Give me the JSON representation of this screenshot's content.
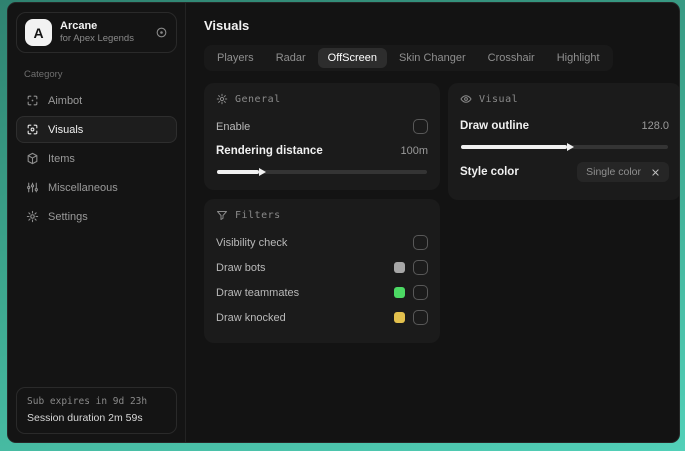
{
  "sidebar": {
    "logo_letter": "A",
    "app_name": "Arcane",
    "app_subtitle": "for Apex Legends",
    "category_label": "Category",
    "items": [
      {
        "label": "Aimbot",
        "active": false
      },
      {
        "label": "Visuals",
        "active": true
      },
      {
        "label": "Items",
        "active": false
      },
      {
        "label": "Miscellaneous",
        "active": false
      },
      {
        "label": "Settings",
        "active": false
      }
    ],
    "footer": {
      "sub_expires": "Sub expires in 9d 23h",
      "session_duration": "Session duration 2m 59s"
    }
  },
  "main": {
    "title": "Visuals",
    "tabs": [
      {
        "label": "Players",
        "active": false
      },
      {
        "label": "Radar",
        "active": false
      },
      {
        "label": "OffScreen",
        "active": true
      },
      {
        "label": "Skin Changer",
        "active": false
      },
      {
        "label": "Crosshair",
        "active": false
      },
      {
        "label": "Highlight",
        "active": false
      }
    ],
    "panels": {
      "general": {
        "title": "General",
        "enable_label": "Enable",
        "enable_checked": false,
        "rendering_distance_label": "Rendering distance",
        "rendering_distance_value": "100m",
        "rendering_distance_percent": 20
      },
      "filters": {
        "title": "Filters",
        "rows": [
          {
            "label": "Visibility check",
            "swatch": null,
            "checked": false
          },
          {
            "label": "Draw bots",
            "swatch": "#a6a6a6",
            "checked": false
          },
          {
            "label": "Draw teammates",
            "swatch": "#4cd964",
            "checked": false
          },
          {
            "label": "Draw knocked",
            "swatch": "#e2c04d",
            "checked": false
          }
        ]
      },
      "visual": {
        "title": "Visual",
        "draw_outline_label": "Draw outline",
        "draw_outline_value": "128.0",
        "draw_outline_percent": 51,
        "style_color_label": "Style color",
        "style_color_value": "Single color"
      }
    }
  },
  "colors": {
    "accent_teal": "#3da78e",
    "window_bg": "#131313",
    "panel_bg": "#1b1b1b",
    "active_tab_bg": "#2d2d2d",
    "slider_fill": "#f2f2f2",
    "swatch_bots": "#a6a6a6",
    "swatch_teammates": "#4cd964",
    "swatch_knocked": "#e2c04d"
  }
}
